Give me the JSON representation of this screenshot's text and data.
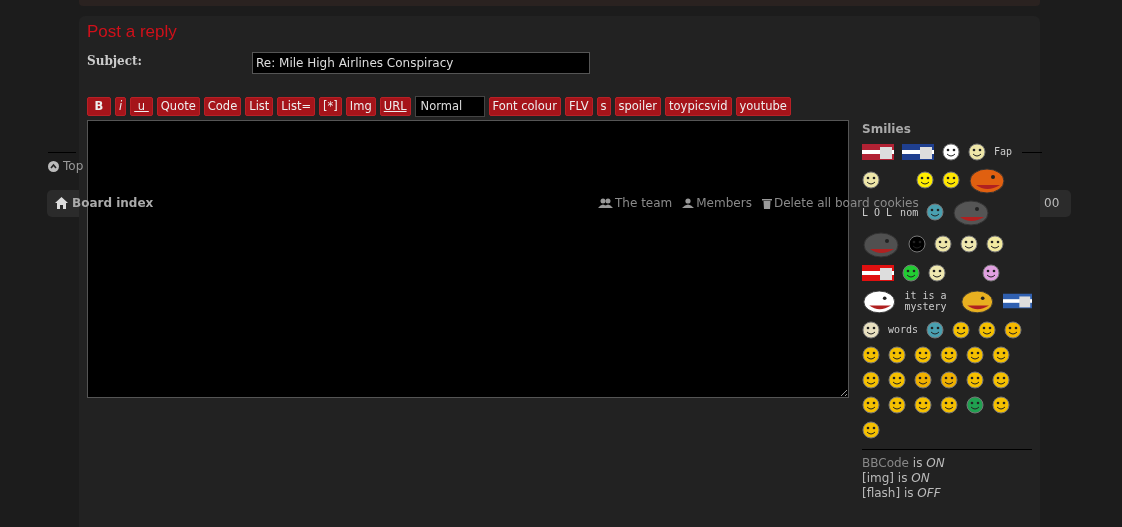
{
  "panel": {
    "title": "Post a reply"
  },
  "subject": {
    "label": "Subject:",
    "value": "Re: Mile High Airlines Conspiracy"
  },
  "toolbar": [
    {
      "kind": "button",
      "label": "B",
      "bold": true,
      "italic": false,
      "underline": false
    },
    {
      "kind": "button",
      "label": "i",
      "bold": false,
      "italic": true,
      "underline": false
    },
    {
      "kind": "button",
      "label": " u ",
      "bold": false,
      "italic": false,
      "underline": true
    },
    {
      "kind": "button",
      "label": "Quote",
      "bold": false,
      "italic": false,
      "underline": false
    },
    {
      "kind": "button",
      "label": "Code",
      "bold": false,
      "italic": false,
      "underline": false
    },
    {
      "kind": "button",
      "label": "List",
      "bold": false,
      "italic": false,
      "underline": false
    },
    {
      "kind": "button",
      "label": "List=",
      "bold": false,
      "italic": false,
      "underline": false
    },
    {
      "kind": "button",
      "label": "[*]",
      "bold": false,
      "italic": false,
      "underline": false
    },
    {
      "kind": "button",
      "label": "Img",
      "bold": false,
      "italic": false,
      "underline": false
    },
    {
      "kind": "button",
      "label": "URL",
      "bold": false,
      "italic": false,
      "underline": true
    },
    {
      "kind": "select",
      "label": "Normal"
    },
    {
      "kind": "button",
      "label": "Font colour",
      "bold": false,
      "italic": false,
      "underline": false
    },
    {
      "kind": "button",
      "label": "FLV",
      "bold": false,
      "italic": false,
      "underline": false
    },
    {
      "kind": "button",
      "label": "s",
      "bold": false,
      "italic": false,
      "underline": false
    },
    {
      "kind": "button",
      "label": "spoiler",
      "bold": false,
      "italic": false,
      "underline": false
    },
    {
      "kind": "button",
      "label": "toypicsvid",
      "bold": false,
      "italic": false,
      "underline": false
    },
    {
      "kind": "button",
      "label": "youtube",
      "bold": false,
      "italic": false,
      "underline": false
    }
  ],
  "smilies": {
    "title": "Smilies",
    "rows": [
      [
        {
          "kind": "flag",
          "color": "#b22234"
        },
        {
          "kind": "flag",
          "color": "#1f3f8f"
        },
        {
          "kind": "face",
          "color": "#ffffff"
        },
        {
          "kind": "face",
          "color": "#eee6a8"
        },
        {
          "kind": "label",
          "text": "Fap"
        }
      ],
      [
        {
          "kind": "face",
          "color": "#eee6a8"
        },
        {
          "kind": "gap"
        },
        {
          "kind": "face",
          "color": "#ffee00"
        },
        {
          "kind": "face",
          "color": "#ffe600"
        },
        {
          "kind": "creature",
          "color": "#e06010"
        }
      ],
      [
        {
          "kind": "label",
          "text": "L O L"
        },
        {
          "kind": "label",
          "text": "nom"
        },
        {
          "kind": "face",
          "color": "#4aa0b0"
        },
        {
          "kind": "creature",
          "color": "#555555"
        }
      ],
      [
        {
          "kind": "creature",
          "color": "#505050"
        },
        {
          "kind": "face",
          "color": "#000000"
        },
        {
          "kind": "face",
          "color": "#eee6a8"
        },
        {
          "kind": "face",
          "color": "#efe8b0"
        },
        {
          "kind": "face",
          "color": "#f2eaa0"
        }
      ],
      [
        {
          "kind": "flag",
          "color": "#e01010"
        },
        {
          "kind": "face",
          "color": "#22cc33"
        },
        {
          "kind": "face",
          "color": "#efe8b0"
        },
        {
          "kind": "gap"
        },
        {
          "kind": "face",
          "color": "#e0a0e0"
        }
      ],
      [
        {
          "kind": "creature",
          "color": "#ffffff"
        },
        {
          "kind": "label",
          "text": "it is a mystery"
        },
        {
          "kind": "creature",
          "color": "#e8b020"
        },
        {
          "kind": "flag",
          "color": "#3060b0"
        }
      ],
      [
        {
          "kind": "face",
          "color": "#e8e0c0"
        },
        {
          "kind": "label",
          "text": "words"
        },
        {
          "kind": "face",
          "color": "#4aa0b0"
        },
        {
          "kind": "face",
          "color": "#f5c000"
        },
        {
          "kind": "face",
          "color": "#f5c000"
        },
        {
          "kind": "face",
          "color": "#f5b800"
        }
      ],
      [
        {
          "kind": "face",
          "color": "#f5c000"
        },
        {
          "kind": "face",
          "color": "#f5c000"
        },
        {
          "kind": "face",
          "color": "#f5c000"
        },
        {
          "kind": "face",
          "color": "#f5c000"
        },
        {
          "kind": "face",
          "color": "#f5c000"
        },
        {
          "kind": "face",
          "color": "#f5c000"
        }
      ],
      [
        {
          "kind": "face",
          "color": "#f5c000"
        },
        {
          "kind": "face",
          "color": "#f5c000"
        },
        {
          "kind": "face",
          "color": "#f0b000"
        },
        {
          "kind": "face",
          "color": "#f0b000"
        },
        {
          "kind": "face",
          "color": "#f5c000"
        },
        {
          "kind": "face",
          "color": "#f5c000"
        }
      ],
      [
        {
          "kind": "face",
          "color": "#f5c000"
        },
        {
          "kind": "face",
          "color": "#f5c000"
        },
        {
          "kind": "face",
          "color": "#f5c000"
        },
        {
          "kind": "face",
          "color": "#f5c000"
        },
        {
          "kind": "face",
          "color": "#20a050"
        },
        {
          "kind": "face",
          "color": "#f5c000"
        }
      ],
      [
        {
          "kind": "face",
          "color": "#f5c000"
        }
      ]
    ]
  },
  "options": [
    {
      "link": "BBCode",
      "text": " is *ON*"
    },
    {
      "text": "[img] is *ON*"
    },
    {
      "text": "[flash] is *OFF*"
    }
  ],
  "footer": {
    "top": "Top",
    "board_index": "Board index",
    "links": [
      "The team",
      "Members",
      "Delete all board cookies"
    ],
    "cut_text": "00"
  }
}
